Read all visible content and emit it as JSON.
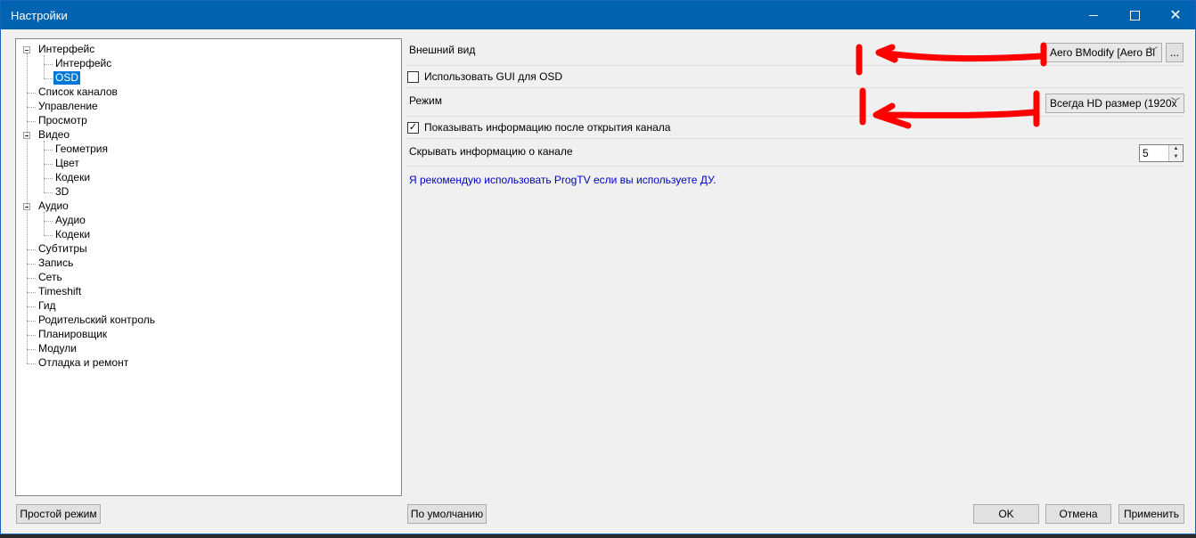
{
  "window": {
    "title": "Настройки"
  },
  "tree": {
    "items": [
      {
        "label": "Интерфейс",
        "level": 0,
        "expanded": true
      },
      {
        "label": "Интерфейс",
        "level": 1
      },
      {
        "label": "OSD",
        "level": 1,
        "selected": true
      },
      {
        "label": "Список каналов",
        "level": 0
      },
      {
        "label": "Управление",
        "level": 0
      },
      {
        "label": "Просмотр",
        "level": 0
      },
      {
        "label": "Видео",
        "level": 0,
        "expanded": true
      },
      {
        "label": "Геометрия",
        "level": 1
      },
      {
        "label": "Цвет",
        "level": 1
      },
      {
        "label": "Кодеки",
        "level": 1
      },
      {
        "label": "3D",
        "level": 1
      },
      {
        "label": "Аудио",
        "level": 0,
        "expanded": true
      },
      {
        "label": "Аудио",
        "level": 1
      },
      {
        "label": "Кодеки",
        "level": 1
      },
      {
        "label": "Субтитры",
        "level": 0
      },
      {
        "label": "Запись",
        "level": 0
      },
      {
        "label": "Сеть",
        "level": 0
      },
      {
        "label": "Timeshift",
        "level": 0
      },
      {
        "label": "Гид",
        "level": 0
      },
      {
        "label": "Родительский контроль",
        "level": 0
      },
      {
        "label": "Планировщик",
        "level": 0
      },
      {
        "label": "Модули",
        "level": 0
      },
      {
        "label": "Отладка и ремонт",
        "level": 0
      }
    ]
  },
  "settings": {
    "appearance_label": "Внешний вид",
    "appearance_value": "Aero BModify  [Aero Bl",
    "appearance_button": "...",
    "use_gui_label": "Использовать GUI для OSD",
    "use_gui_checked": false,
    "mode_label": "Режим",
    "mode_value": "Всегда HD размер (1920x",
    "show_info_label": "Показывать информацию после открытия канала",
    "show_info_checked": true,
    "hide_info_label": "Скрывать информацию о канале",
    "hide_info_value": "5",
    "recommend_text": "Я рекомендую использовать ProgTV если вы используете ДУ."
  },
  "buttons": {
    "simple_mode": "Простой режим",
    "defaults": "По умолчанию",
    "ok": "OK",
    "cancel": "Отмена",
    "apply": "Применить"
  },
  "colors": {
    "titlebar": "#0063b1",
    "selection": "#0078d7",
    "link": "#0000c8",
    "annotation": "#ff0000"
  }
}
